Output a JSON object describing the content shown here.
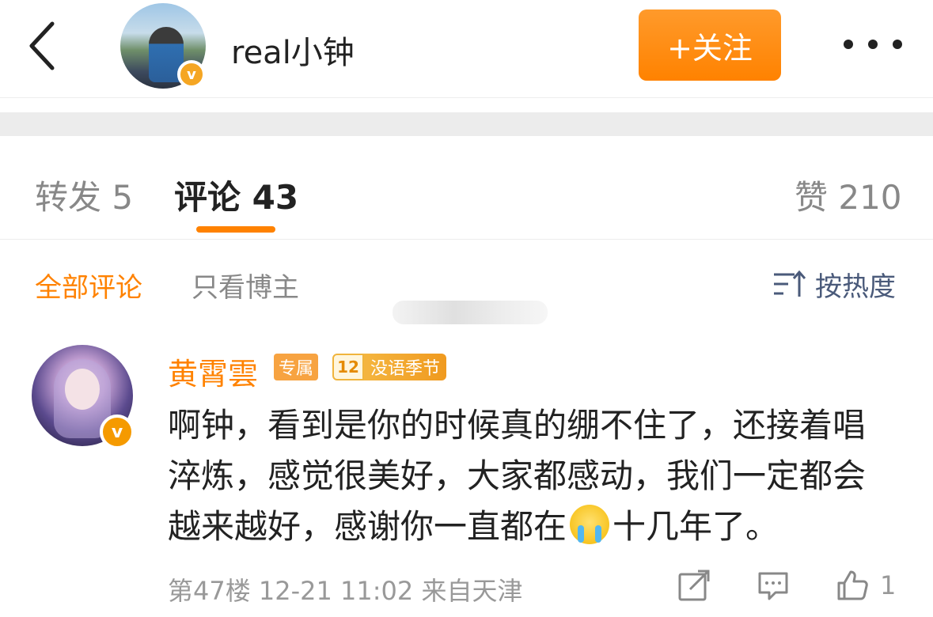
{
  "header": {
    "username": "real小钟",
    "follow_label": "+关注",
    "back_icon": "chevron-left-icon",
    "more_icon": "more-dots-icon",
    "verify_mark": "v"
  },
  "tabs": {
    "repost": "转发 5",
    "comment": "评论 43",
    "like": "赞 210",
    "active": "comment"
  },
  "filter": {
    "all": "全部评论",
    "author_only": "只看博主",
    "sort": "按热度"
  },
  "comment": {
    "name": "黄霄雲",
    "badge_exclusive": "专属",
    "badge_level": "12",
    "badge_season": "没语季节",
    "verify_mark": "v",
    "text_part1": "啊钟，看到是你的时候真的绷不住了，还接着唱淬炼，感觉很美好，大家都感动，我们一定都会越来越好，感谢你一直都在",
    "emoji": "crying-emoji",
    "text_part2": "十几年了。",
    "meta": "第47楼 12-21 11:02 来自天津",
    "like_count": "1"
  },
  "colors": {
    "accent": "#ff8200",
    "sort_blue": "#4a5a7a",
    "muted": "#999999"
  }
}
